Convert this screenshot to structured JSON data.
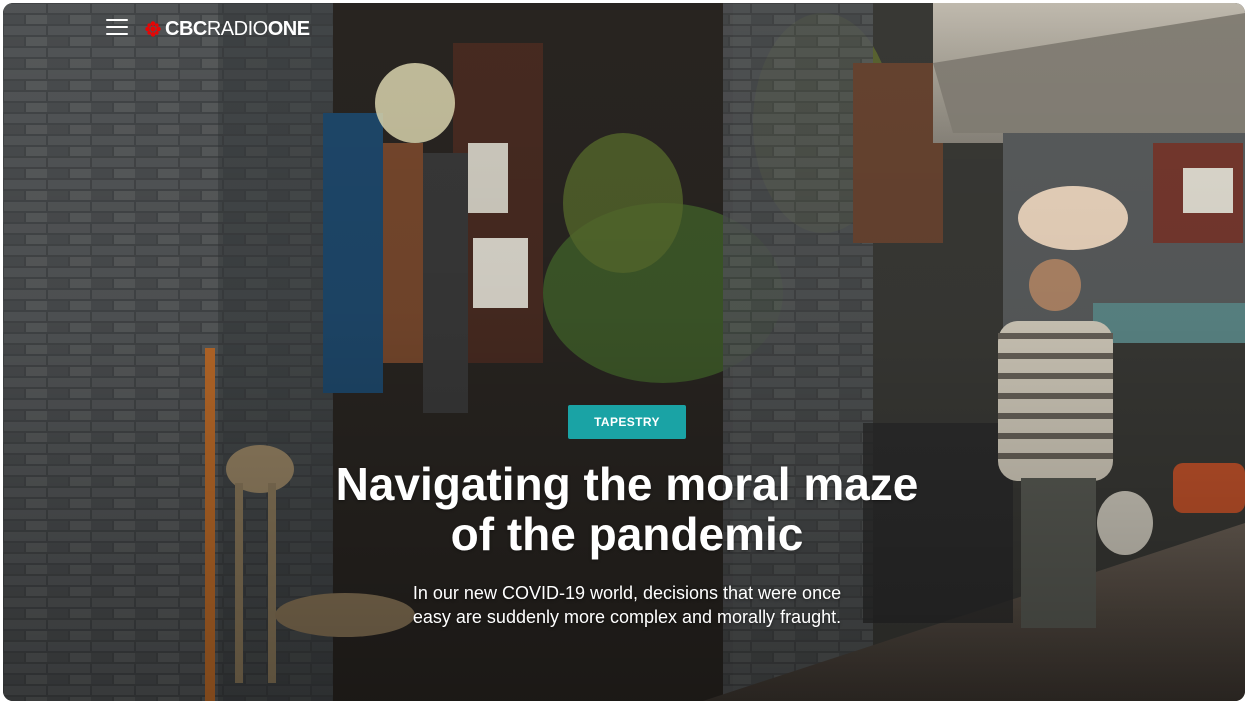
{
  "header": {
    "menu_icon": "hamburger-menu-icon",
    "logo": {
      "icon": "cbc-gem-icon",
      "brand_bold": "CBC",
      "brand_light": "RADIO",
      "brand_bold_2": "ONE",
      "gem_color": "#e60505"
    }
  },
  "hero": {
    "category": "TAPESTRY",
    "headline": "Navigating the moral maze of the pandemic",
    "deck": "In our new COVID-19 world, decisions that were once easy are suddenly more complex and morally fraught."
  },
  "colors": {
    "badge": "#1aa3a5",
    "text": "#ffffff"
  }
}
